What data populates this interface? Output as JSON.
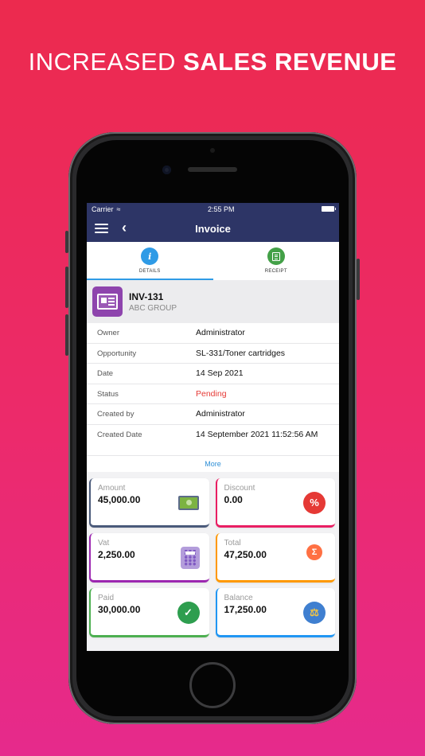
{
  "banner": {
    "light": "INCREASED ",
    "bold": "SALES REVENUE"
  },
  "status_bar": {
    "carrier": "Carrier",
    "time": "2:55 PM"
  },
  "nav": {
    "title": "Invoice"
  },
  "tabs": [
    {
      "label": "DETAILS",
      "icon": "info-icon",
      "color": "#2f9be6"
    },
    {
      "label": "RECEIPT",
      "icon": "receipt-icon",
      "color": "#43a047"
    }
  ],
  "record": {
    "number": "INV-131",
    "company": "ABC GROUP"
  },
  "details": [
    {
      "key": "Owner",
      "value": "Administrator"
    },
    {
      "key": "Opportunity",
      "value": "SL-331/Toner cartridges"
    },
    {
      "key": "Date",
      "value": "14 Sep 2021"
    },
    {
      "key": "Status",
      "value": "Pending"
    },
    {
      "key": "Created by",
      "value": "Administrator"
    },
    {
      "key": "Created Date",
      "value": "14 September 2021 11:52:56 AM"
    }
  ],
  "more_link": "More",
  "cards": [
    {
      "label": "Amount",
      "value": "45,000.00",
      "icon": "cash-register-icon",
      "color": "#4a5a7a"
    },
    {
      "label": "Discount",
      "value": "0.00",
      "icon": "percent-badge-icon",
      "color": "#e91e63"
    },
    {
      "label": "Vat",
      "value": "2,250.00",
      "icon": "calculator-icon",
      "color": "#9c27b0"
    },
    {
      "label": "Total",
      "value": "47,250.00",
      "icon": "sigma-tree-icon",
      "color": "#ff9800"
    },
    {
      "label": "Paid",
      "value": "30,000.00",
      "icon": "check-badge-icon",
      "color": "#4caf50"
    },
    {
      "label": "Balance",
      "value": "17,250.00",
      "icon": "scales-icon",
      "color": "#2196f3"
    }
  ]
}
